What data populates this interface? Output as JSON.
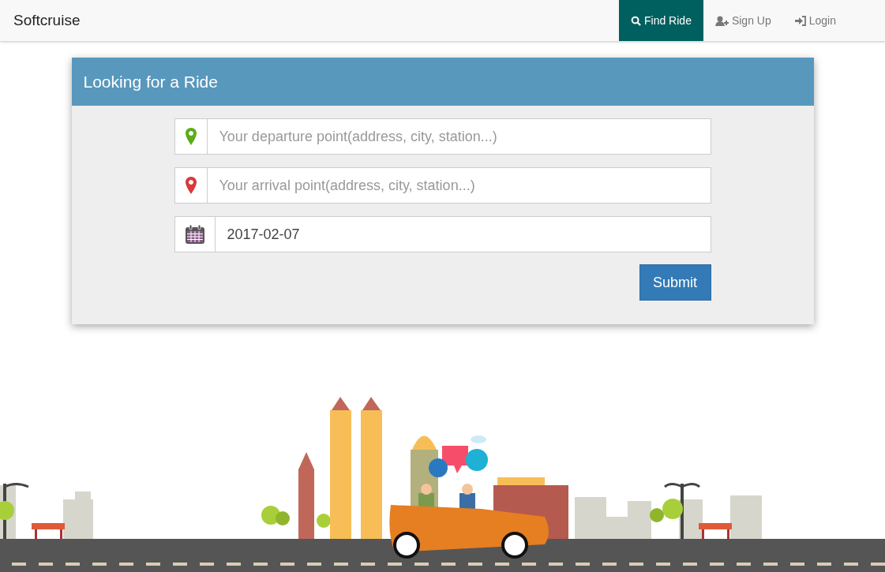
{
  "navbar": {
    "brand": "Softcruise",
    "items": [
      {
        "label": "Find Ride",
        "selected": true
      },
      {
        "label": "Sign Up",
        "selected": false
      },
      {
        "label": "Login",
        "selected": false
      }
    ]
  },
  "card": {
    "title": "Looking for a Ride",
    "fields": [
      {
        "kind": "location",
        "placeholder": "Your departure point(address, city, station...)",
        "color": "#5aad1a"
      },
      {
        "kind": "location",
        "placeholder": "Your arrival point(address, city, station...)",
        "color": "#d9393a"
      },
      {
        "kind": "date",
        "value": "2017-02-07"
      }
    ],
    "submit": "Submit"
  }
}
